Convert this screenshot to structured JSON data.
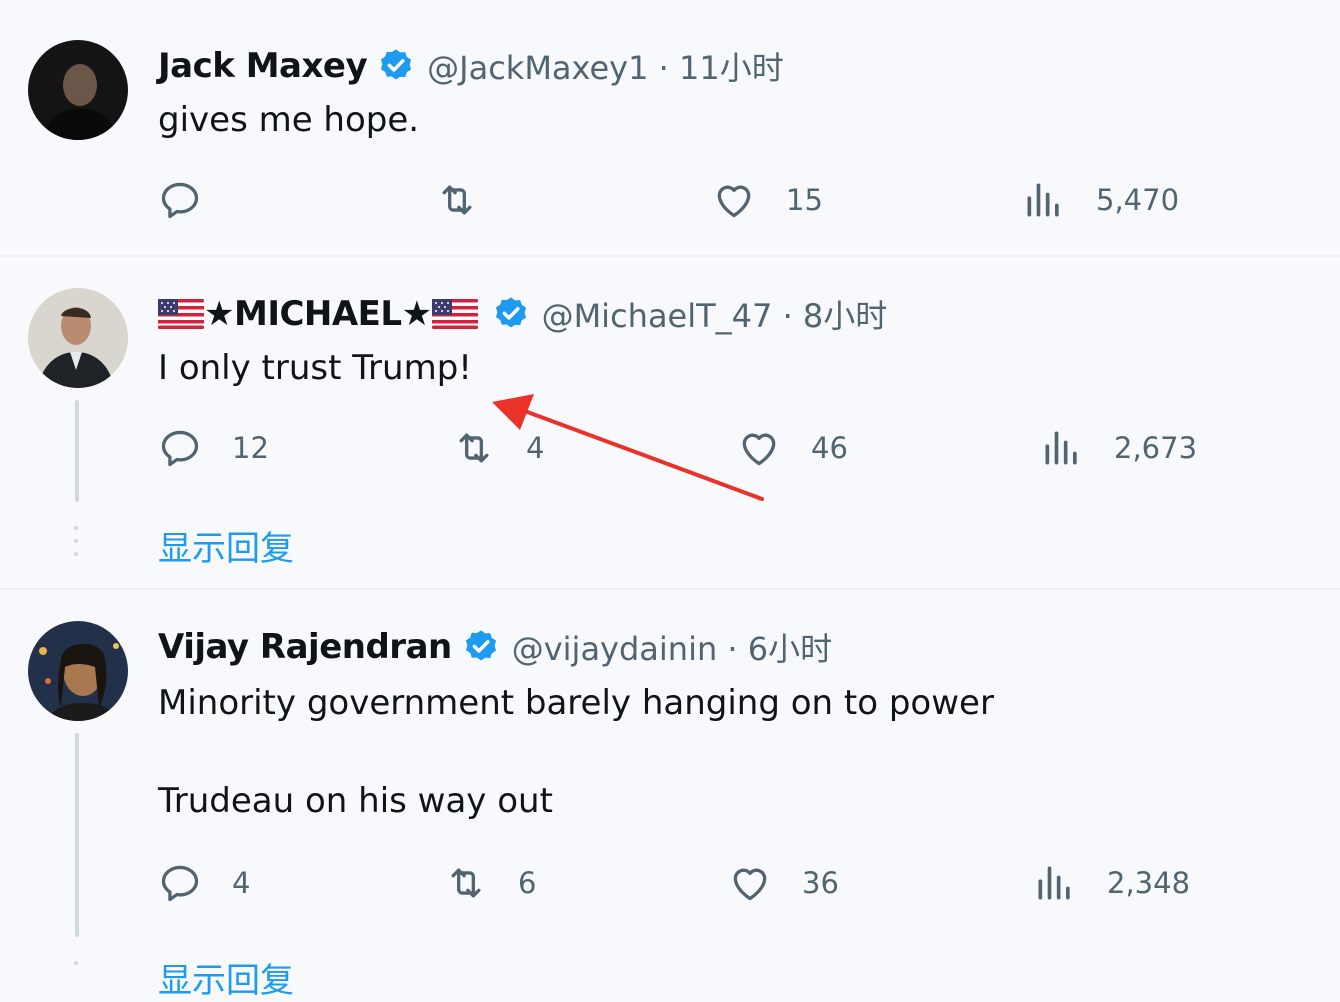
{
  "colors": {
    "accent": "#1d9bf0",
    "annotation_arrow": "#e8322a",
    "muted": "#536471"
  },
  "tweets": [
    {
      "name": "Jack Maxey",
      "verified": true,
      "handle_time": "@JackMaxey1 · 11小时",
      "text": "gives me hope.",
      "reply_count": "",
      "retweet_count": "",
      "like_count": "15",
      "view_count": "5,470"
    },
    {
      "name": "★MICHAEL★",
      "name_flags": "us-flag-icon",
      "verified": true,
      "handle_time": "@MichaelT_47 · 8小时",
      "text": "I only trust Trump!",
      "reply_count": "12",
      "retweet_count": "4",
      "like_count": "46",
      "view_count": "2,673",
      "show_replies": "显示回复"
    },
    {
      "name": "Vijay Rajendran",
      "verified": true,
      "handle_time": "@vijaydainin · 6小时",
      "text_line1": "Minority government barely hanging on to power",
      "text_line2": "Trudeau on his way out",
      "reply_count": "4",
      "retweet_count": "6",
      "like_count": "36",
      "view_count": "2,348",
      "show_replies": "显示回复"
    }
  ],
  "icons": [
    "reply-icon",
    "retweet-icon",
    "like-icon",
    "views-icon",
    "verified-badge-icon",
    "us-flag-icon",
    "red-arrow-annotation"
  ]
}
